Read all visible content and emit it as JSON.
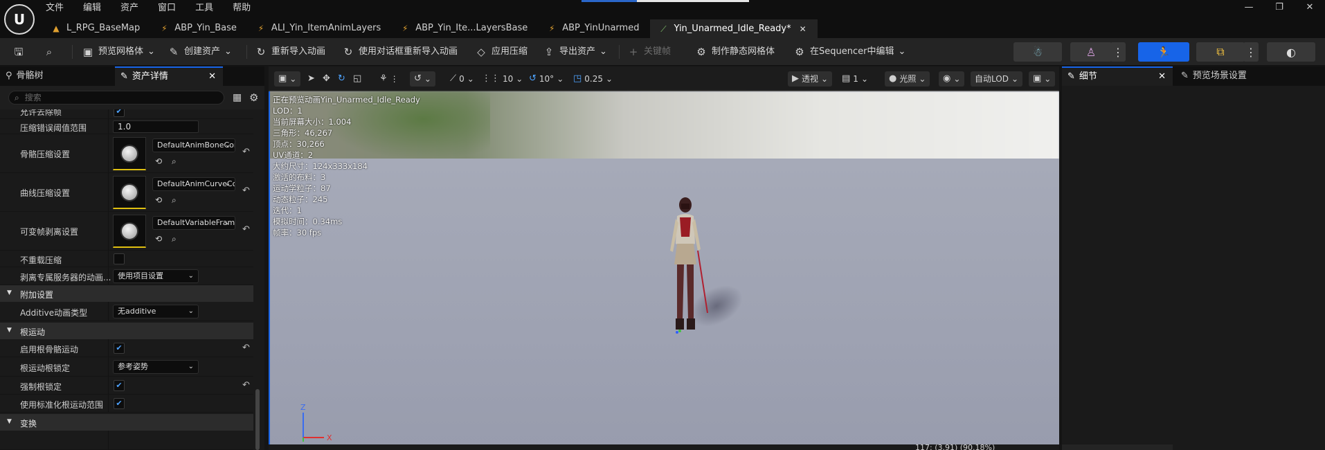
{
  "menu": [
    "文件",
    "编辑",
    "资产",
    "窗口",
    "工具",
    "帮助"
  ],
  "logo_text": "U",
  "window_controls": [
    "—",
    "❐",
    "✕"
  ],
  "doc_tabs": [
    {
      "label": "L_RPG_BaseMap",
      "icon": "map-icon",
      "active": false
    },
    {
      "label": "ABP_Yin_Base",
      "icon": "anim-blueprint-icon",
      "active": false
    },
    {
      "label": "ALI_Yin_ItemAnimLayers",
      "icon": "anim-layer-icon",
      "active": false
    },
    {
      "label": "ABP_Yin_Ite...LayersBase",
      "icon": "anim-blueprint-icon",
      "active": false
    },
    {
      "label": "ABP_YinUnarmed",
      "icon": "anim-blueprint-icon",
      "active": false
    },
    {
      "label": "Yin_Unarmed_Idle_Ready*",
      "icon": "anim-sequence-icon",
      "active": true
    }
  ],
  "toolbar": {
    "preview_mesh": "预览网格体",
    "create_asset": "创建资产",
    "reimport": "重新导入动画",
    "reimport_dialog": "使用对话框重新导入动画",
    "apply_compression": "应用压缩",
    "export_asset": "导出资产",
    "keyframe": "关键帧",
    "make_static_mesh": "制作静态网格体",
    "edit_in_sequencer": "在Sequencer中编辑"
  },
  "left_panel": {
    "tabs": [
      "骨骼树",
      "资产详情"
    ],
    "search_placeholder": "搜索",
    "rows": {
      "allow_frame_strip": "允许去除帧",
      "compression_error_label": "压缩错误阈值范围",
      "compression_error_value": "1.0",
      "bone_compression_label": "骨骼压缩设置",
      "bone_compression_value": "DefaultAnimBoneCompressionSettings",
      "curve_compression_label": "曲线压缩设置",
      "curve_compression_value": "DefaultAnimCurveCompressionSettings",
      "variable_frame_label": "可变帧剥离设置",
      "variable_frame_value": "DefaultVariableFrameStrippingSettings",
      "no_recompress_label": "不重载压缩",
      "strip_server_label": "剥离专属服务器的动画...",
      "strip_server_value": "使用项目设置",
      "additive_section": "附加设置",
      "additive_type_label": "Additive动画类型",
      "additive_type_value": "无additive",
      "root_motion_section": "根运动",
      "enable_root_motion_label": "启用根骨骼运动",
      "root_lock_label": "根运动根锁定",
      "root_lock_value": "参考姿势",
      "force_root_lock_label": "强制根锁定",
      "normalized_range_label": "使用标准化根运动范围",
      "transform_section": "变换"
    }
  },
  "viewport": {
    "controls": {
      "snap_rot": "0",
      "grid_size": "10",
      "rot_snap": "10°",
      "scale_snap": "0.25",
      "view_mode": "透视",
      "lod_num": "1",
      "lighting": "光照",
      "auto_lod": "自动LOD"
    },
    "stats": [
      "正在预览动画Yin_Unarmed_Idle_Ready",
      "LOD：1",
      "当前屏幕大小：1.004",
      "三角形：46,267",
      "顶点：30,266",
      "UV通道：2",
      "大约尺寸：124x333x184",
      "激活的布料：3",
      "运动学粒子：87",
      "动态粒子：245",
      "迭代：1",
      "模拟时间：0.34ms",
      "帧率：30 fps"
    ],
    "readout": "117: (3.91) (90.18%)",
    "axis_x": "X",
    "axis_z": "Z"
  },
  "right_panel": {
    "tabs": [
      "细节",
      "预览场景设置"
    ]
  },
  "colors": {
    "accent": "#1764e8",
    "thumb_underline": "#e0c010",
    "panel_bg": "#1a1a1a",
    "toolbar_bg": "#242424"
  }
}
